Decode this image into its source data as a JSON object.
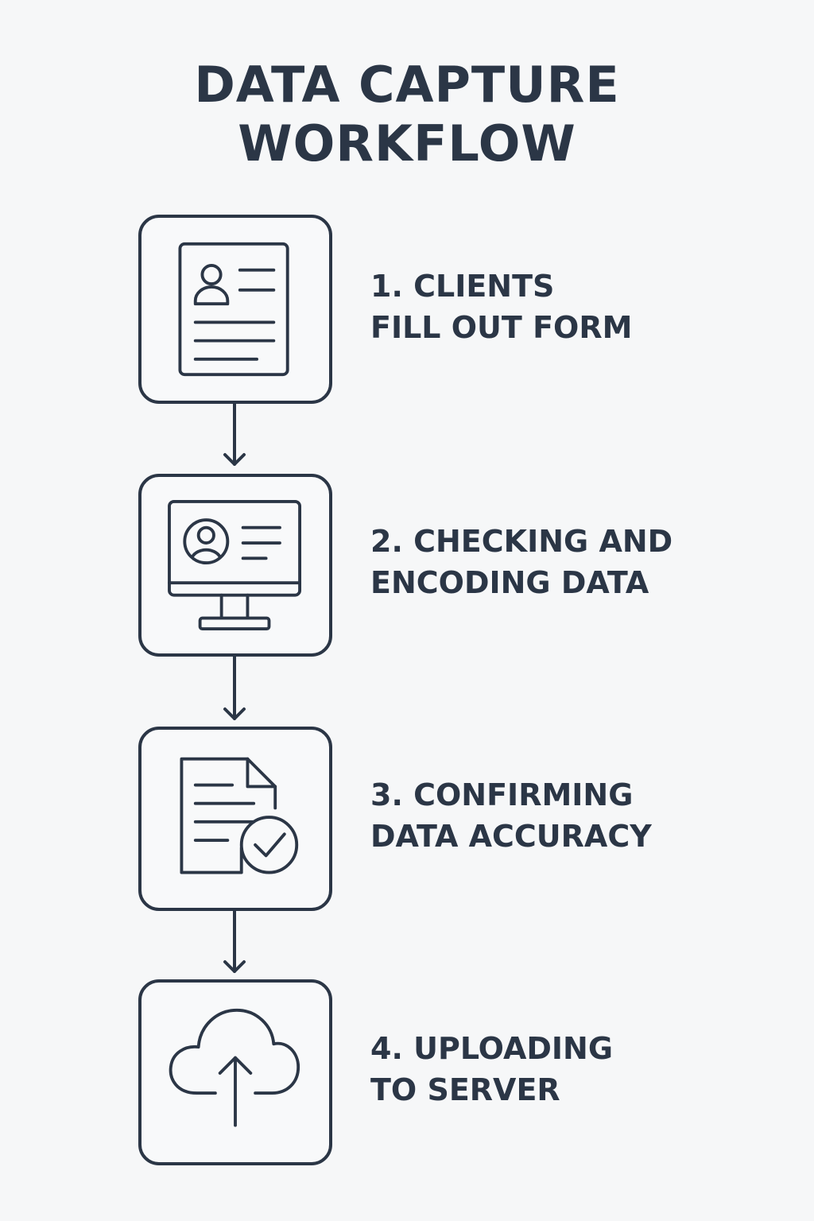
{
  "title": {
    "line1": "DATA CAPTURE",
    "line2": "WORKFLOW"
  },
  "steps": [
    {
      "line1": "1. CLIENTS",
      "line2": "FILL OUT FORM",
      "icon": "form-document-icon"
    },
    {
      "line1": "2. CHECKING AND",
      "line2": "ENCODING DATA",
      "icon": "computer-monitor-icon"
    },
    {
      "line1": "3. CONFIRMING",
      "line2": "DATA ACCURACY",
      "icon": "document-check-icon"
    },
    {
      "line1": "4. UPLOADING",
      "line2": "TO SERVER",
      "icon": "cloud-upload-icon"
    }
  ],
  "colors": {
    "ink": "#2b3646",
    "background": "#f6f7f8"
  }
}
